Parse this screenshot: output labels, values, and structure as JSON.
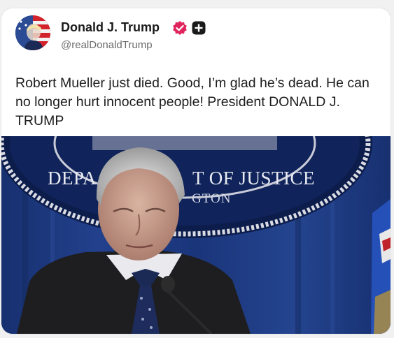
{
  "post": {
    "author": {
      "display_name": "Donald J. Trump",
      "handle": "@realDonaldTrump",
      "verified": true
    },
    "text": "Robert Mueller just died. Good, I’m glad he’s dead. He can no longer hurt innocent people! President DONALD J. TRUMP",
    "media": {
      "seal_text_left": "DEPA",
      "seal_text_right": "T OF JUSTICE",
      "seal_subtext": "GTON"
    }
  },
  "colors": {
    "verified_badge": "#e0245e",
    "curtain_blue": "#1c3a86",
    "seal_navy": "#0d1f52"
  },
  "icons": {
    "verified": "verified-badge-icon",
    "follow": "plus-square-icon"
  }
}
